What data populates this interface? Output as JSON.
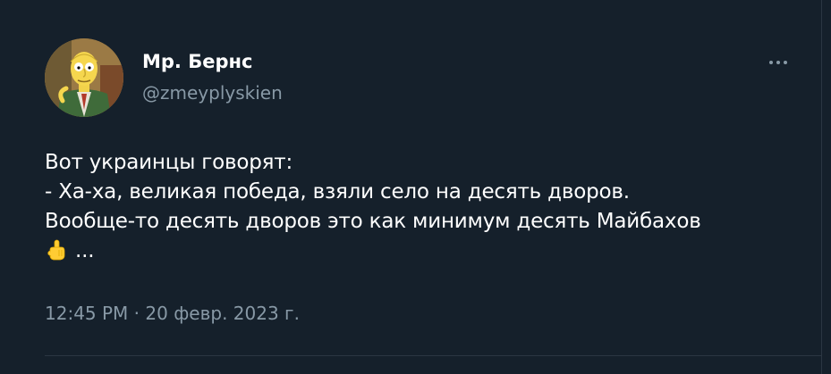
{
  "tweet": {
    "author": {
      "display_name": "Мр. Бернс",
      "handle": "@zmeyplyskien",
      "avatar_icon": "mr-burns-avatar"
    },
    "more_icon": "more-dots-icon",
    "text_lines": [
      "Вот украинцы говорят:",
      "- Ха-ха, великая победа, взяли село на десять дворов.",
      "Вообще-то десять дворов это как минимум десять Майбахов"
    ],
    "last_line_emoji": "index-pointing-up-emoji",
    "last_line_text": "...",
    "time": "12:45 PM",
    "separator": "·",
    "date": "20 февр. 2023 г."
  },
  "colors": {
    "background": "#15202b",
    "text_primary": "#ffffff",
    "text_secondary": "#8899a6",
    "divider": "#2b3642"
  }
}
